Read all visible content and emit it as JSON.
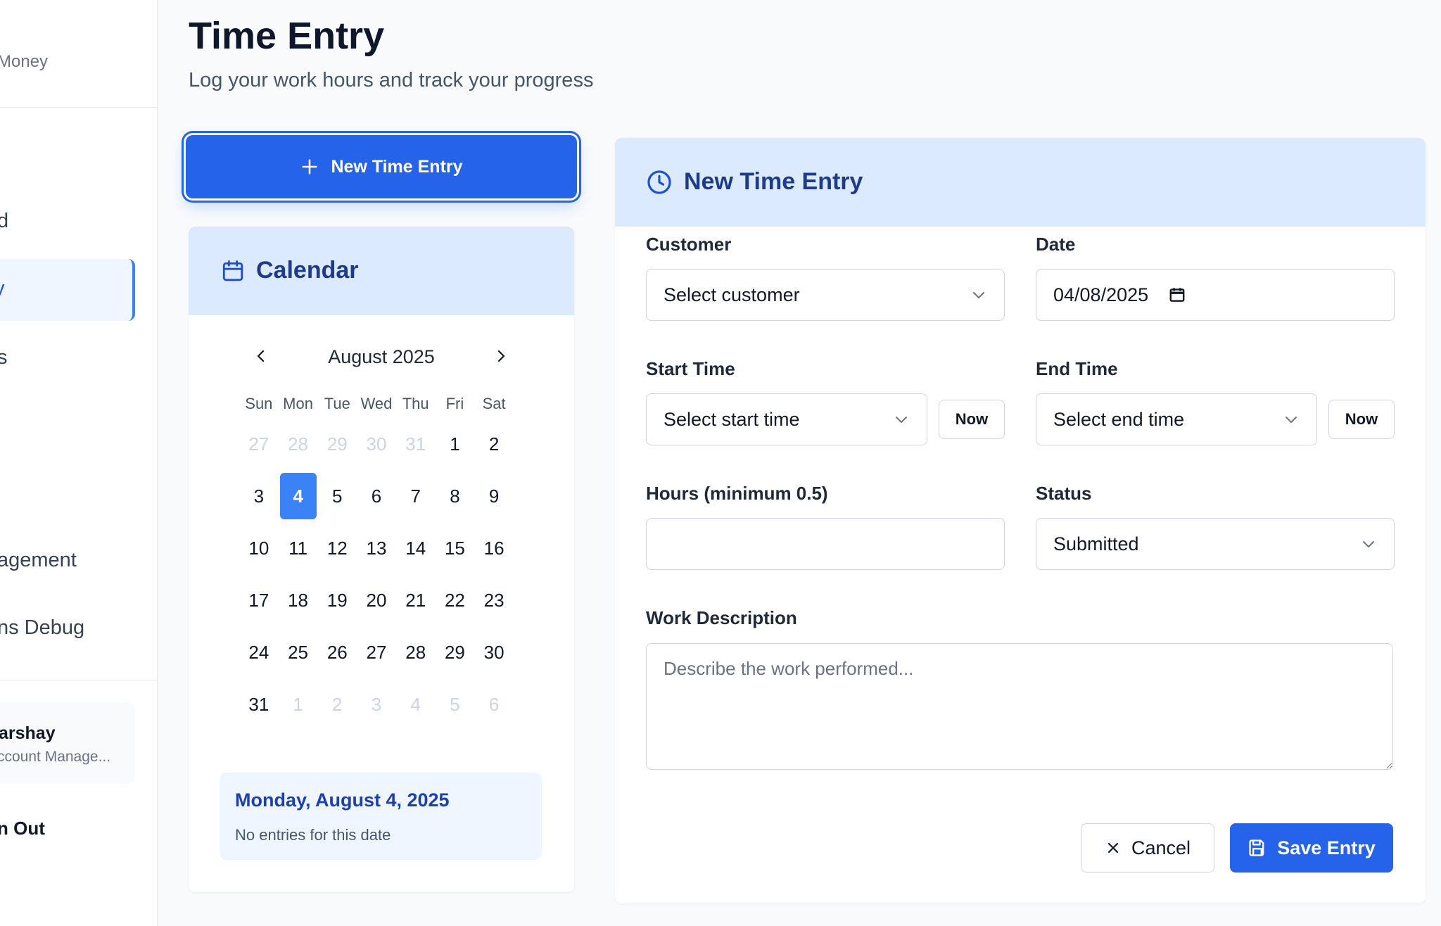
{
  "colors": {
    "accent": "#2563eb",
    "accent_light": "#dbeafe",
    "selected_day": "#3b82f6",
    "heading_blue": "#1e3a8a"
  },
  "sidebar": {
    "brand_sub": "Money",
    "nav": [
      {
        "label": "d"
      },
      {
        "label": "y",
        "active": true
      },
      {
        "label": "s"
      },
      {
        "label": "agement"
      },
      {
        "label": "ns Debug"
      }
    ],
    "user": {
      "name": "arshay",
      "role": "ccount Manage..."
    },
    "sign_out": "n Out"
  },
  "header": {
    "title": "Time Entry",
    "subtitle": "Log your work hours and track your progress"
  },
  "new_entry_button": {
    "label": "New Time Entry",
    "icon": "plus-icon"
  },
  "calendar": {
    "title": "Calendar",
    "icon": "calendar-icon",
    "month_label": "August 2025",
    "weekdays": [
      "Sun",
      "Mon",
      "Tue",
      "Wed",
      "Thu",
      "Fri",
      "Sat"
    ],
    "weeks": [
      [
        {
          "d": "27",
          "m": true
        },
        {
          "d": "28",
          "m": true
        },
        {
          "d": "29",
          "m": true
        },
        {
          "d": "30",
          "m": true
        },
        {
          "d": "31",
          "m": true
        },
        {
          "d": "1"
        },
        {
          "d": "2"
        }
      ],
      [
        {
          "d": "3"
        },
        {
          "d": "4",
          "sel": true
        },
        {
          "d": "5"
        },
        {
          "d": "6"
        },
        {
          "d": "7"
        },
        {
          "d": "8"
        },
        {
          "d": "9"
        }
      ],
      [
        {
          "d": "10"
        },
        {
          "d": "11"
        },
        {
          "d": "12"
        },
        {
          "d": "13"
        },
        {
          "d": "14"
        },
        {
          "d": "15"
        },
        {
          "d": "16"
        }
      ],
      [
        {
          "d": "17"
        },
        {
          "d": "18"
        },
        {
          "d": "19"
        },
        {
          "d": "20"
        },
        {
          "d": "21"
        },
        {
          "d": "22"
        },
        {
          "d": "23"
        }
      ],
      [
        {
          "d": "24"
        },
        {
          "d": "25"
        },
        {
          "d": "26"
        },
        {
          "d": "27"
        },
        {
          "d": "28"
        },
        {
          "d": "29"
        },
        {
          "d": "30"
        }
      ],
      [
        {
          "d": "31"
        },
        {
          "d": "1",
          "m": true
        },
        {
          "d": "2",
          "m": true
        },
        {
          "d": "3",
          "m": true
        },
        {
          "d": "4",
          "m": true
        },
        {
          "d": "5",
          "m": true
        },
        {
          "d": "6",
          "m": true
        }
      ]
    ],
    "selected_date_label": "Monday, August 4, 2025",
    "entries_text": "No entries for this date"
  },
  "form": {
    "title": "New Time Entry",
    "icon": "clock-icon",
    "customer": {
      "label": "Customer",
      "value": "Select customer"
    },
    "date": {
      "label": "Date",
      "value": "04/08/2025"
    },
    "start_time": {
      "label": "Start Time",
      "value": "Select start time",
      "now_label": "Now"
    },
    "end_time": {
      "label": "End Time",
      "value": "Select end time",
      "now_label": "Now"
    },
    "hours": {
      "label": "Hours (minimum 0.5)",
      "value": ""
    },
    "status": {
      "label": "Status",
      "value": "Submitted"
    },
    "description": {
      "label": "Work Description",
      "placeholder": "Describe the work performed..."
    },
    "cancel_label": "Cancel",
    "save_label": "Save Entry"
  }
}
